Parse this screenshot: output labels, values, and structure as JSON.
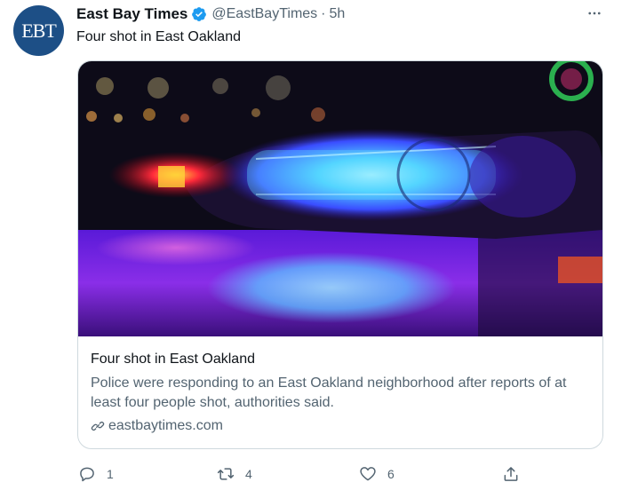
{
  "tweet": {
    "author": {
      "avatar_text": "EBT",
      "display_name": "East Bay Times",
      "handle": "@EastBayTimes",
      "separator": "·",
      "time": "5h",
      "verified": true
    },
    "text": "Four shot in East Oakland",
    "card": {
      "image_icon": "police-lights-photo",
      "title": "Four shot in East Oakland",
      "description": "Police were responding to an East Oakland neighborhood after reports of at least four people shot, authorities said.",
      "link_text": "eastbaytimes.com"
    },
    "actions": {
      "replies": "1",
      "retweets": "4",
      "likes": "6"
    }
  },
  "colors": {
    "brand_blue": "#1d9bf0",
    "avatar_bg": "#1d4f86",
    "text_primary": "#0f1419",
    "text_secondary": "#536471",
    "border": "#cfd9de"
  }
}
